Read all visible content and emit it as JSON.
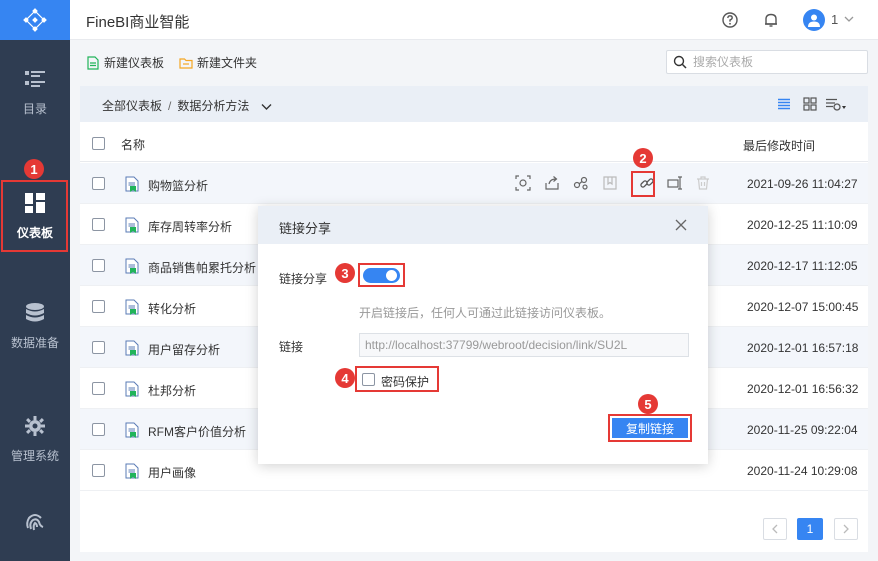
{
  "app": {
    "title": "FineBI商业智能",
    "user_num": "1"
  },
  "sidebar": {
    "items": [
      {
        "label": "目录",
        "icon": "catalog-icon"
      },
      {
        "label": "仪表板",
        "icon": "dashboard-icon",
        "active": true
      },
      {
        "label": "数据准备",
        "icon": "database-icon"
      },
      {
        "label": "管理系统",
        "icon": "gear-icon"
      },
      {
        "label": "",
        "icon": "fingerprint-icon"
      }
    ]
  },
  "toolbar": {
    "new_dashboard": "新建仪表板",
    "new_folder": "新建文件夹",
    "search_placeholder": "搜索仪表板"
  },
  "breadcrumb": {
    "root": "全部仪表板",
    "sep": "/",
    "current": "数据分析方法"
  },
  "table": {
    "col_name": "名称",
    "col_time": "最后修改时间",
    "rows": [
      {
        "name": "购物篮分析",
        "time": "2021-09-26 11:04:27"
      },
      {
        "name": "库存周转率分析",
        "time": "2020-12-25 11:10:09"
      },
      {
        "name": "商品销售帕累托分析",
        "time": "2020-12-17 11:12:05"
      },
      {
        "name": "转化分析",
        "time": "2020-12-07 15:00:45"
      },
      {
        "name": "用户留存分析",
        "time": "2020-12-01 16:57:18"
      },
      {
        "name": "杜邦分析",
        "time": "2020-12-01 16:56:32"
      },
      {
        "name": "RFM客户价值分析",
        "time": "2020-11-25 09:22:04"
      },
      {
        "name": "用户画像",
        "time": "2020-11-24 10:29:08"
      }
    ]
  },
  "pager": {
    "current": "1"
  },
  "dialog": {
    "title": "链接分享",
    "share_label": "链接分享",
    "hint": "开启链接后，任何人可通过此链接访问仪表板。",
    "link_label": "链接",
    "link_value": "http://localhost:37799/webroot/decision/link/SU2L",
    "password_label": "密码保护",
    "copy_button": "复制链接"
  },
  "markers": [
    "1",
    "2",
    "3",
    "4",
    "5"
  ],
  "colors": {
    "accent": "#3685f2",
    "sidebar": "#2f3d52",
    "marker": "#e53935",
    "file_green": "#21b45a"
  }
}
